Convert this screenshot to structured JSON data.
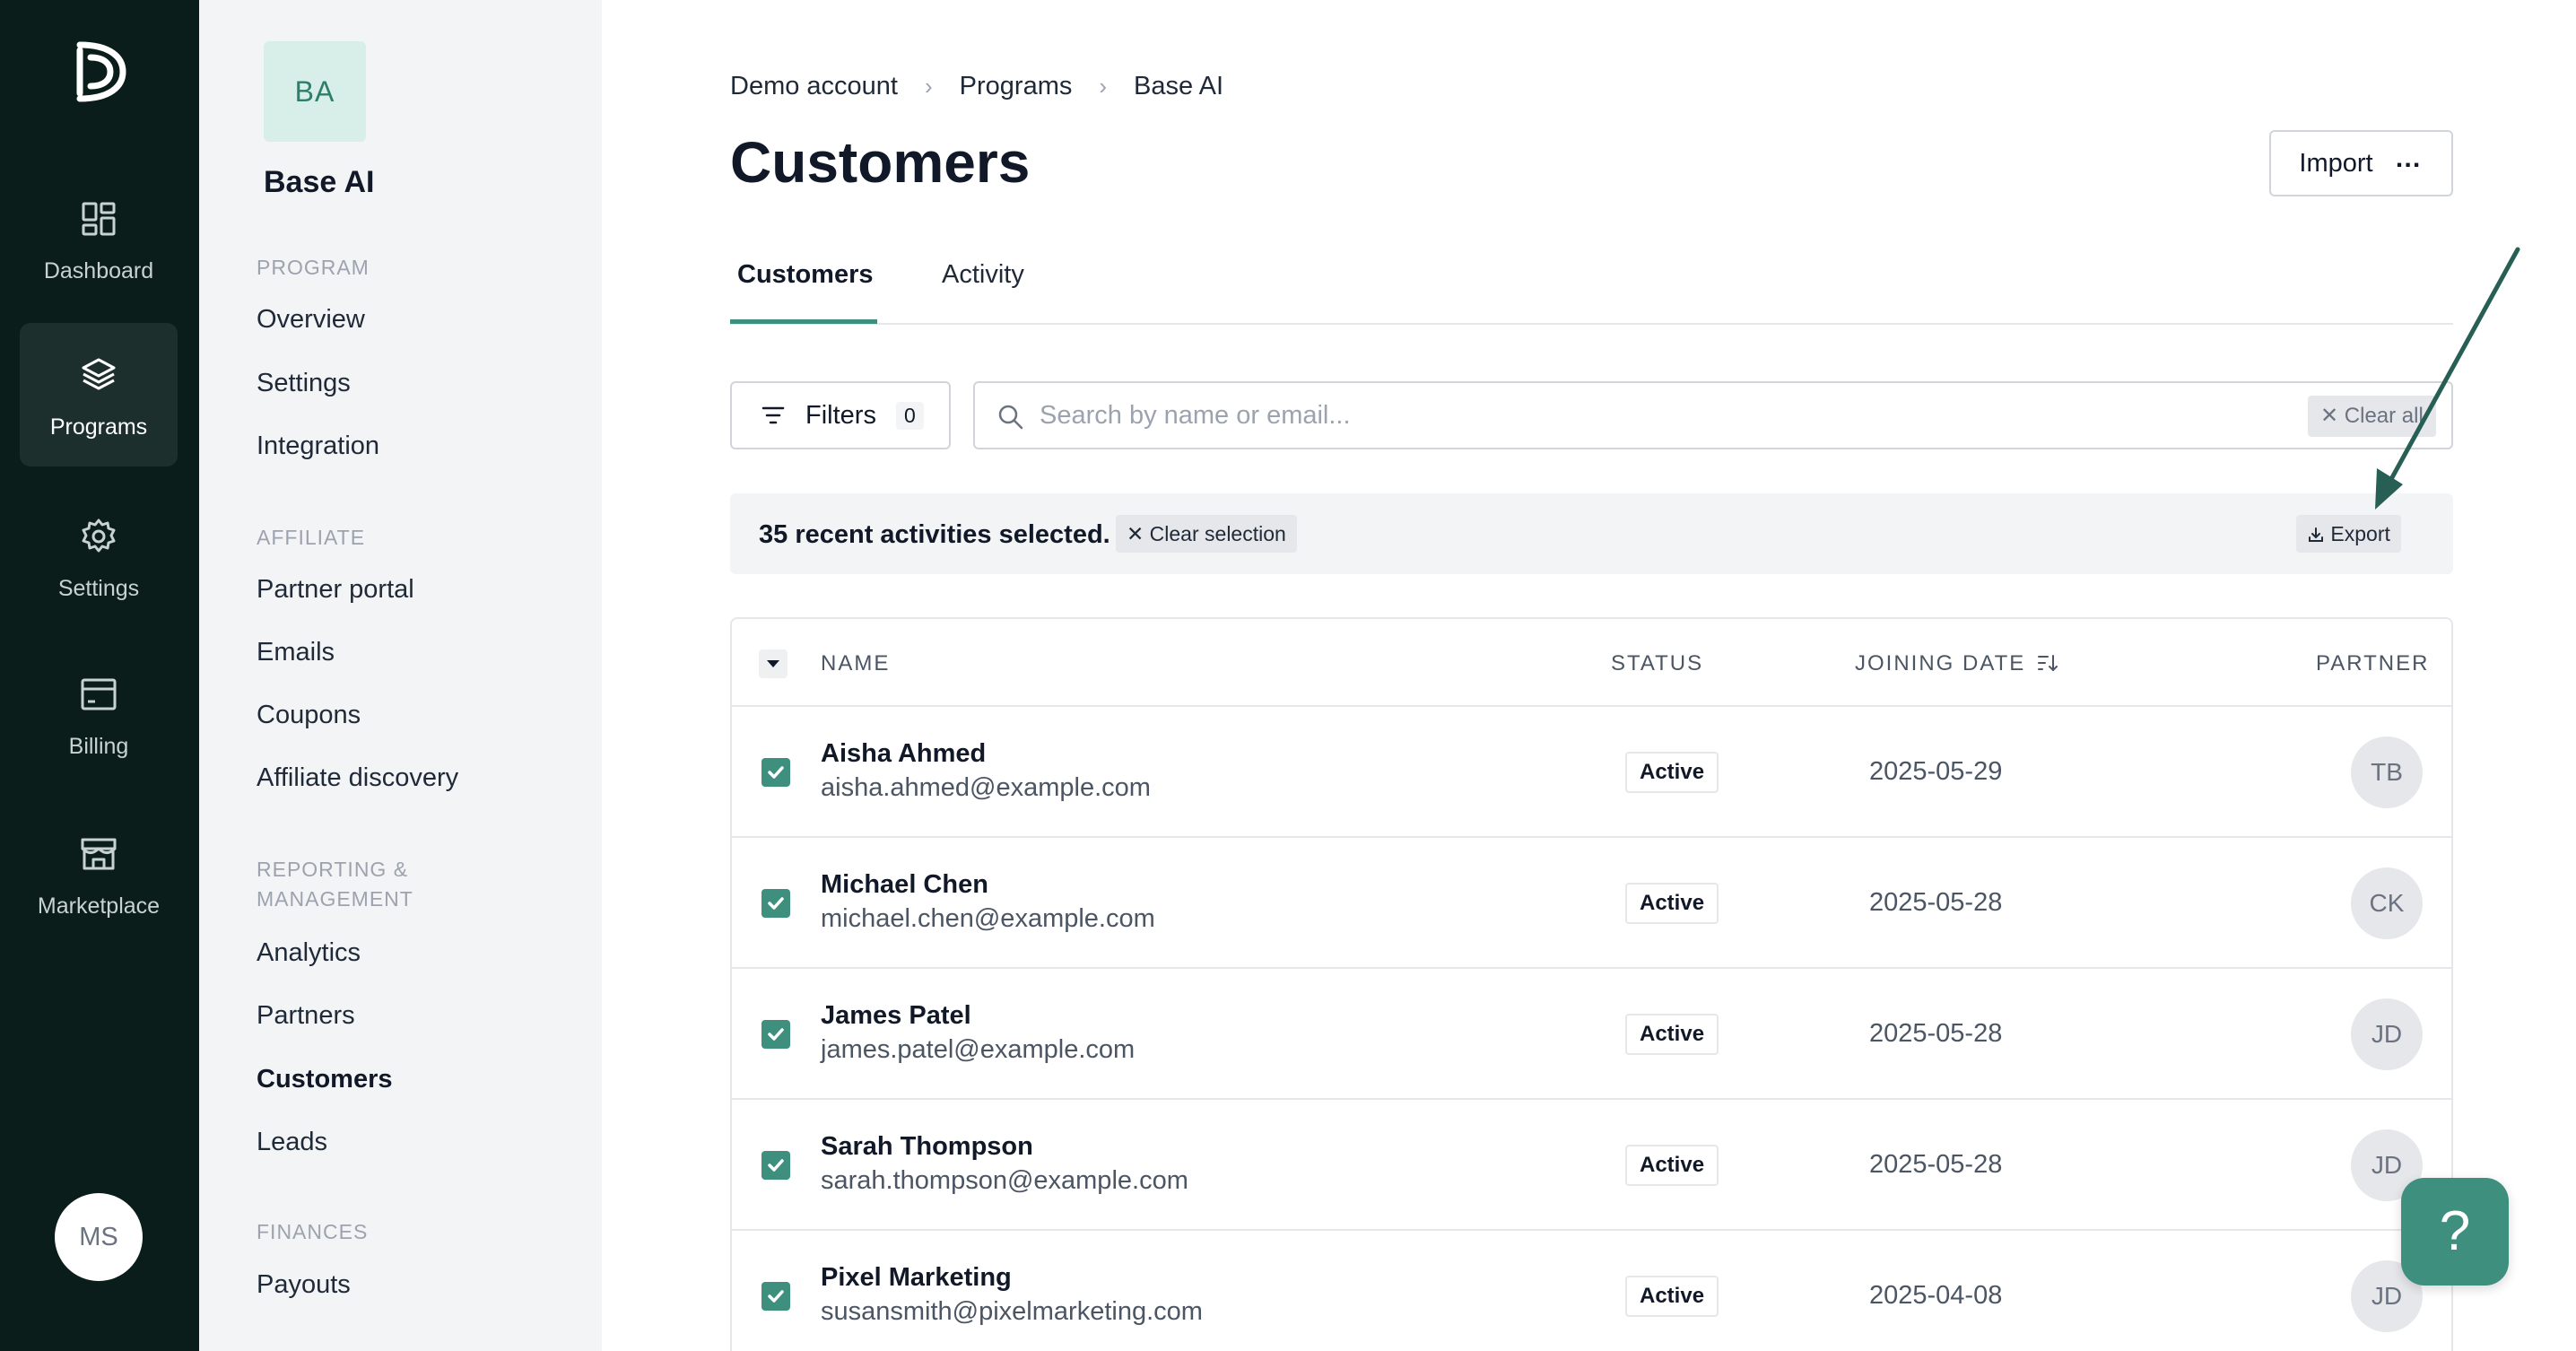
{
  "rail": {
    "items": [
      {
        "label": "Dashboard",
        "icon": "dashboard-icon"
      },
      {
        "label": "Programs",
        "icon": "layers-icon",
        "active": true
      },
      {
        "label": "Settings",
        "icon": "gear-icon"
      },
      {
        "label": "Billing",
        "icon": "billing-icon"
      },
      {
        "label": "Marketplace",
        "icon": "store-icon"
      }
    ],
    "user_initials": "MS"
  },
  "program": {
    "badge": "BA",
    "name": "Base AI"
  },
  "sidebar": {
    "sections": {
      "program": "PROGRAM",
      "affiliate": "AFFILIATE",
      "reporting": "REPORTING & MANAGEMENT",
      "finances": "FINANCES"
    },
    "items": {
      "overview": "Overview",
      "settings": "Settings",
      "integration": "Integration",
      "partner_portal": "Partner portal",
      "emails": "Emails",
      "coupons": "Coupons",
      "affiliate_discovery": "Affiliate discovery",
      "analytics": "Analytics",
      "partners": "Partners",
      "customers": "Customers",
      "leads": "Leads",
      "payouts": "Payouts"
    }
  },
  "breadcrumb": [
    "Demo account",
    "Programs",
    "Base AI"
  ],
  "page_title": "Customers",
  "import_label": "Import",
  "tabs": [
    "Customers",
    "Activity"
  ],
  "filters": {
    "label": "Filters",
    "count": "0"
  },
  "search": {
    "placeholder": "Search by name or email...",
    "clear_label": "Clear all"
  },
  "selection": {
    "text": "35 recent activities selected.",
    "clear_label": "Clear selection",
    "export_label": "Export"
  },
  "table": {
    "headers": {
      "name": "NAME",
      "status": "STATUS",
      "joining_date": "JOINING DATE",
      "partner": "PARTNER"
    },
    "rows": [
      {
        "name": "Aisha Ahmed",
        "email": "aisha.ahmed@example.com",
        "status": "Active",
        "date": "2025-05-29",
        "partner": "TB"
      },
      {
        "name": "Michael Chen",
        "email": "michael.chen@example.com",
        "status": "Active",
        "date": "2025-05-28",
        "partner": "CK"
      },
      {
        "name": "James Patel",
        "email": "james.patel@example.com",
        "status": "Active",
        "date": "2025-05-28",
        "partner": "JD"
      },
      {
        "name": "Sarah Thompson",
        "email": "sarah.thompson@example.com",
        "status": "Active",
        "date": "2025-05-28",
        "partner": "JD"
      },
      {
        "name": "Pixel Marketing",
        "email": "susansmith@pixelmarketing.com",
        "status": "Active",
        "date": "2025-04-08",
        "partner": "JD"
      }
    ]
  },
  "help_label": "?",
  "colors": {
    "rail_bg": "#0b1d1a",
    "accent": "#3f8f7f",
    "badge_bg": "#d7efe8",
    "annotation_arrow": "#275f55"
  }
}
